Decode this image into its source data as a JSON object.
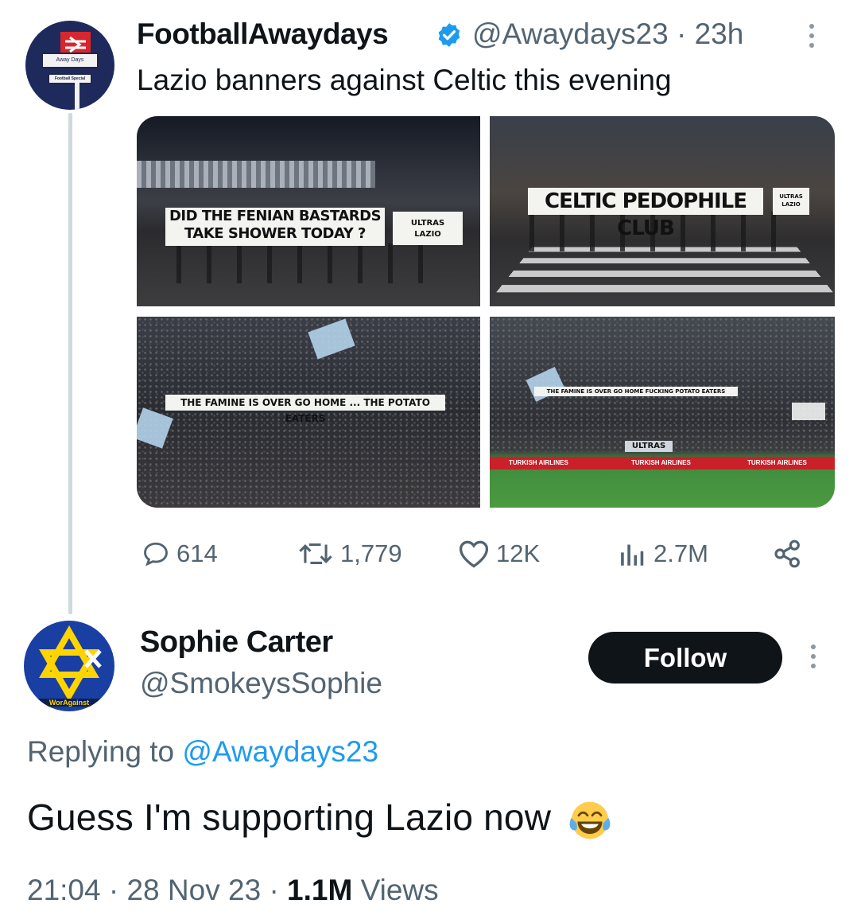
{
  "tweet1": {
    "display_name": "FootballAwaydays",
    "handle": "@Awaydays23",
    "separator": "·",
    "time": "23h",
    "text": "Lazio banners against Celtic this evening",
    "avatar_sign_top": "Away Days",
    "avatar_sign_bottom": "Football Special",
    "media": {
      "banner1_line1": "DID THE FENIAN BASTARDS",
      "banner1_line2": "TAKE SHOWER TODAY ?",
      "banner1_tag_line1": "ULTRAS",
      "banner1_tag_line2": "LAZIO",
      "banner2": "CELTIC PEDOPHILE CLUB",
      "banner2_tag_line1": "ULTRAS",
      "banner2_tag_line2": "LAZIO",
      "banner3": "THE FAMINE IS OVER GO HOME ... THE POTATO EATERS",
      "banner4": "THE FAMINE IS OVER GO HOME FUCKING POTATO EATERS",
      "banner4_ultras": "ULTRAS",
      "ad_text": "TURKISH AIRLINES"
    },
    "stats": {
      "replies": "614",
      "retweets": "1,779",
      "likes": "12K",
      "views": "2.7M"
    },
    "colors": {
      "verified": "#1d9bf0",
      "muted": "#536471"
    }
  },
  "tweet2": {
    "display_name": "Sophie Carter",
    "handle": "@SmokeysSophie",
    "follow_label": "Follow",
    "avatar_text": "WorAgainst",
    "replying_prefix": "Replying to",
    "replying_to": "@Awaydays23",
    "text": "Guess I'm supporting Lazio now",
    "emoji": "face-with-tears-of-joy",
    "time": "21:04",
    "separator": "·",
    "date": "28 Nov 23",
    "views_count": "1.1M",
    "views_label": "Views"
  }
}
